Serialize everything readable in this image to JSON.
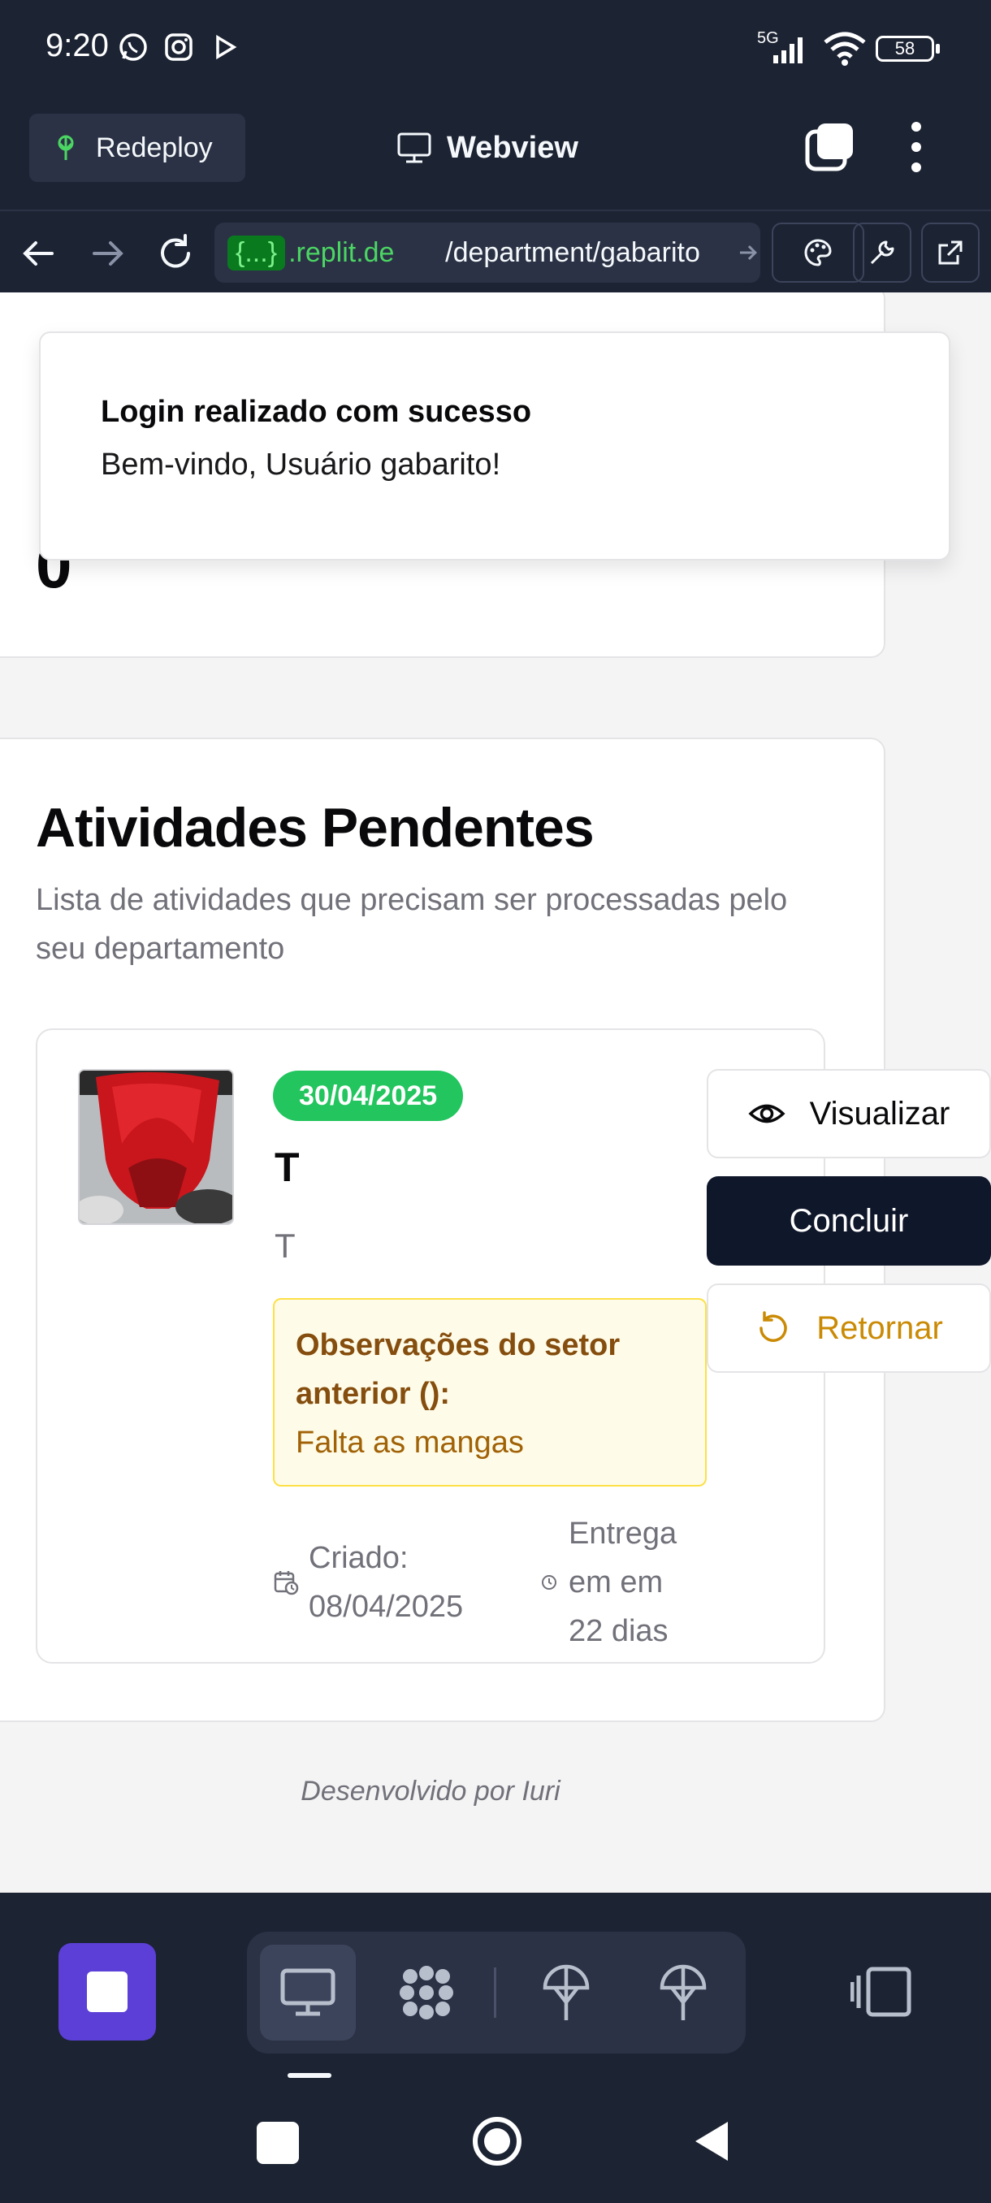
{
  "status_bar": {
    "time": "9:20",
    "network": "5G",
    "battery": "58",
    "icons": [
      "whatsapp-icon",
      "instagram-icon",
      "play-icon",
      "signal-icon",
      "wifi-icon",
      "battery-icon"
    ]
  },
  "top_bar": {
    "redeploy_label": "Redeploy",
    "title": "Webview"
  },
  "address_bar": {
    "badge": "{...}",
    "host": ".replit.de",
    "path": "/department/gabarito"
  },
  "webview": {
    "stats_value": "0",
    "toast": {
      "title": "Login realizado com sucesso",
      "description": "Bem-vindo, Usuário gabarito!"
    },
    "pending": {
      "title": "Atividades Pendentes",
      "subtitle": "Lista de atividades que precisam ser processadas pelo seu departamento",
      "activity": {
        "date_badge": "30/04/2025",
        "title": "T",
        "description": "T",
        "obs_label": "Observações do setor anterior ():",
        "obs_text": "Falta as mangas",
        "created": "Criado: 08/04/2025",
        "due": "Entrega em em 22 dias",
        "buttons": {
          "view": "Visualizar",
          "complete": "Concluir",
          "return": "Retornar"
        }
      }
    },
    "footer": "Desenvolvido por Iuri"
  },
  "colors": {
    "accent_purple": "#5b3fd6",
    "badge_green": "#22c55e",
    "primary_dark": "#0f172a",
    "warning_text": "#ca8a04"
  }
}
